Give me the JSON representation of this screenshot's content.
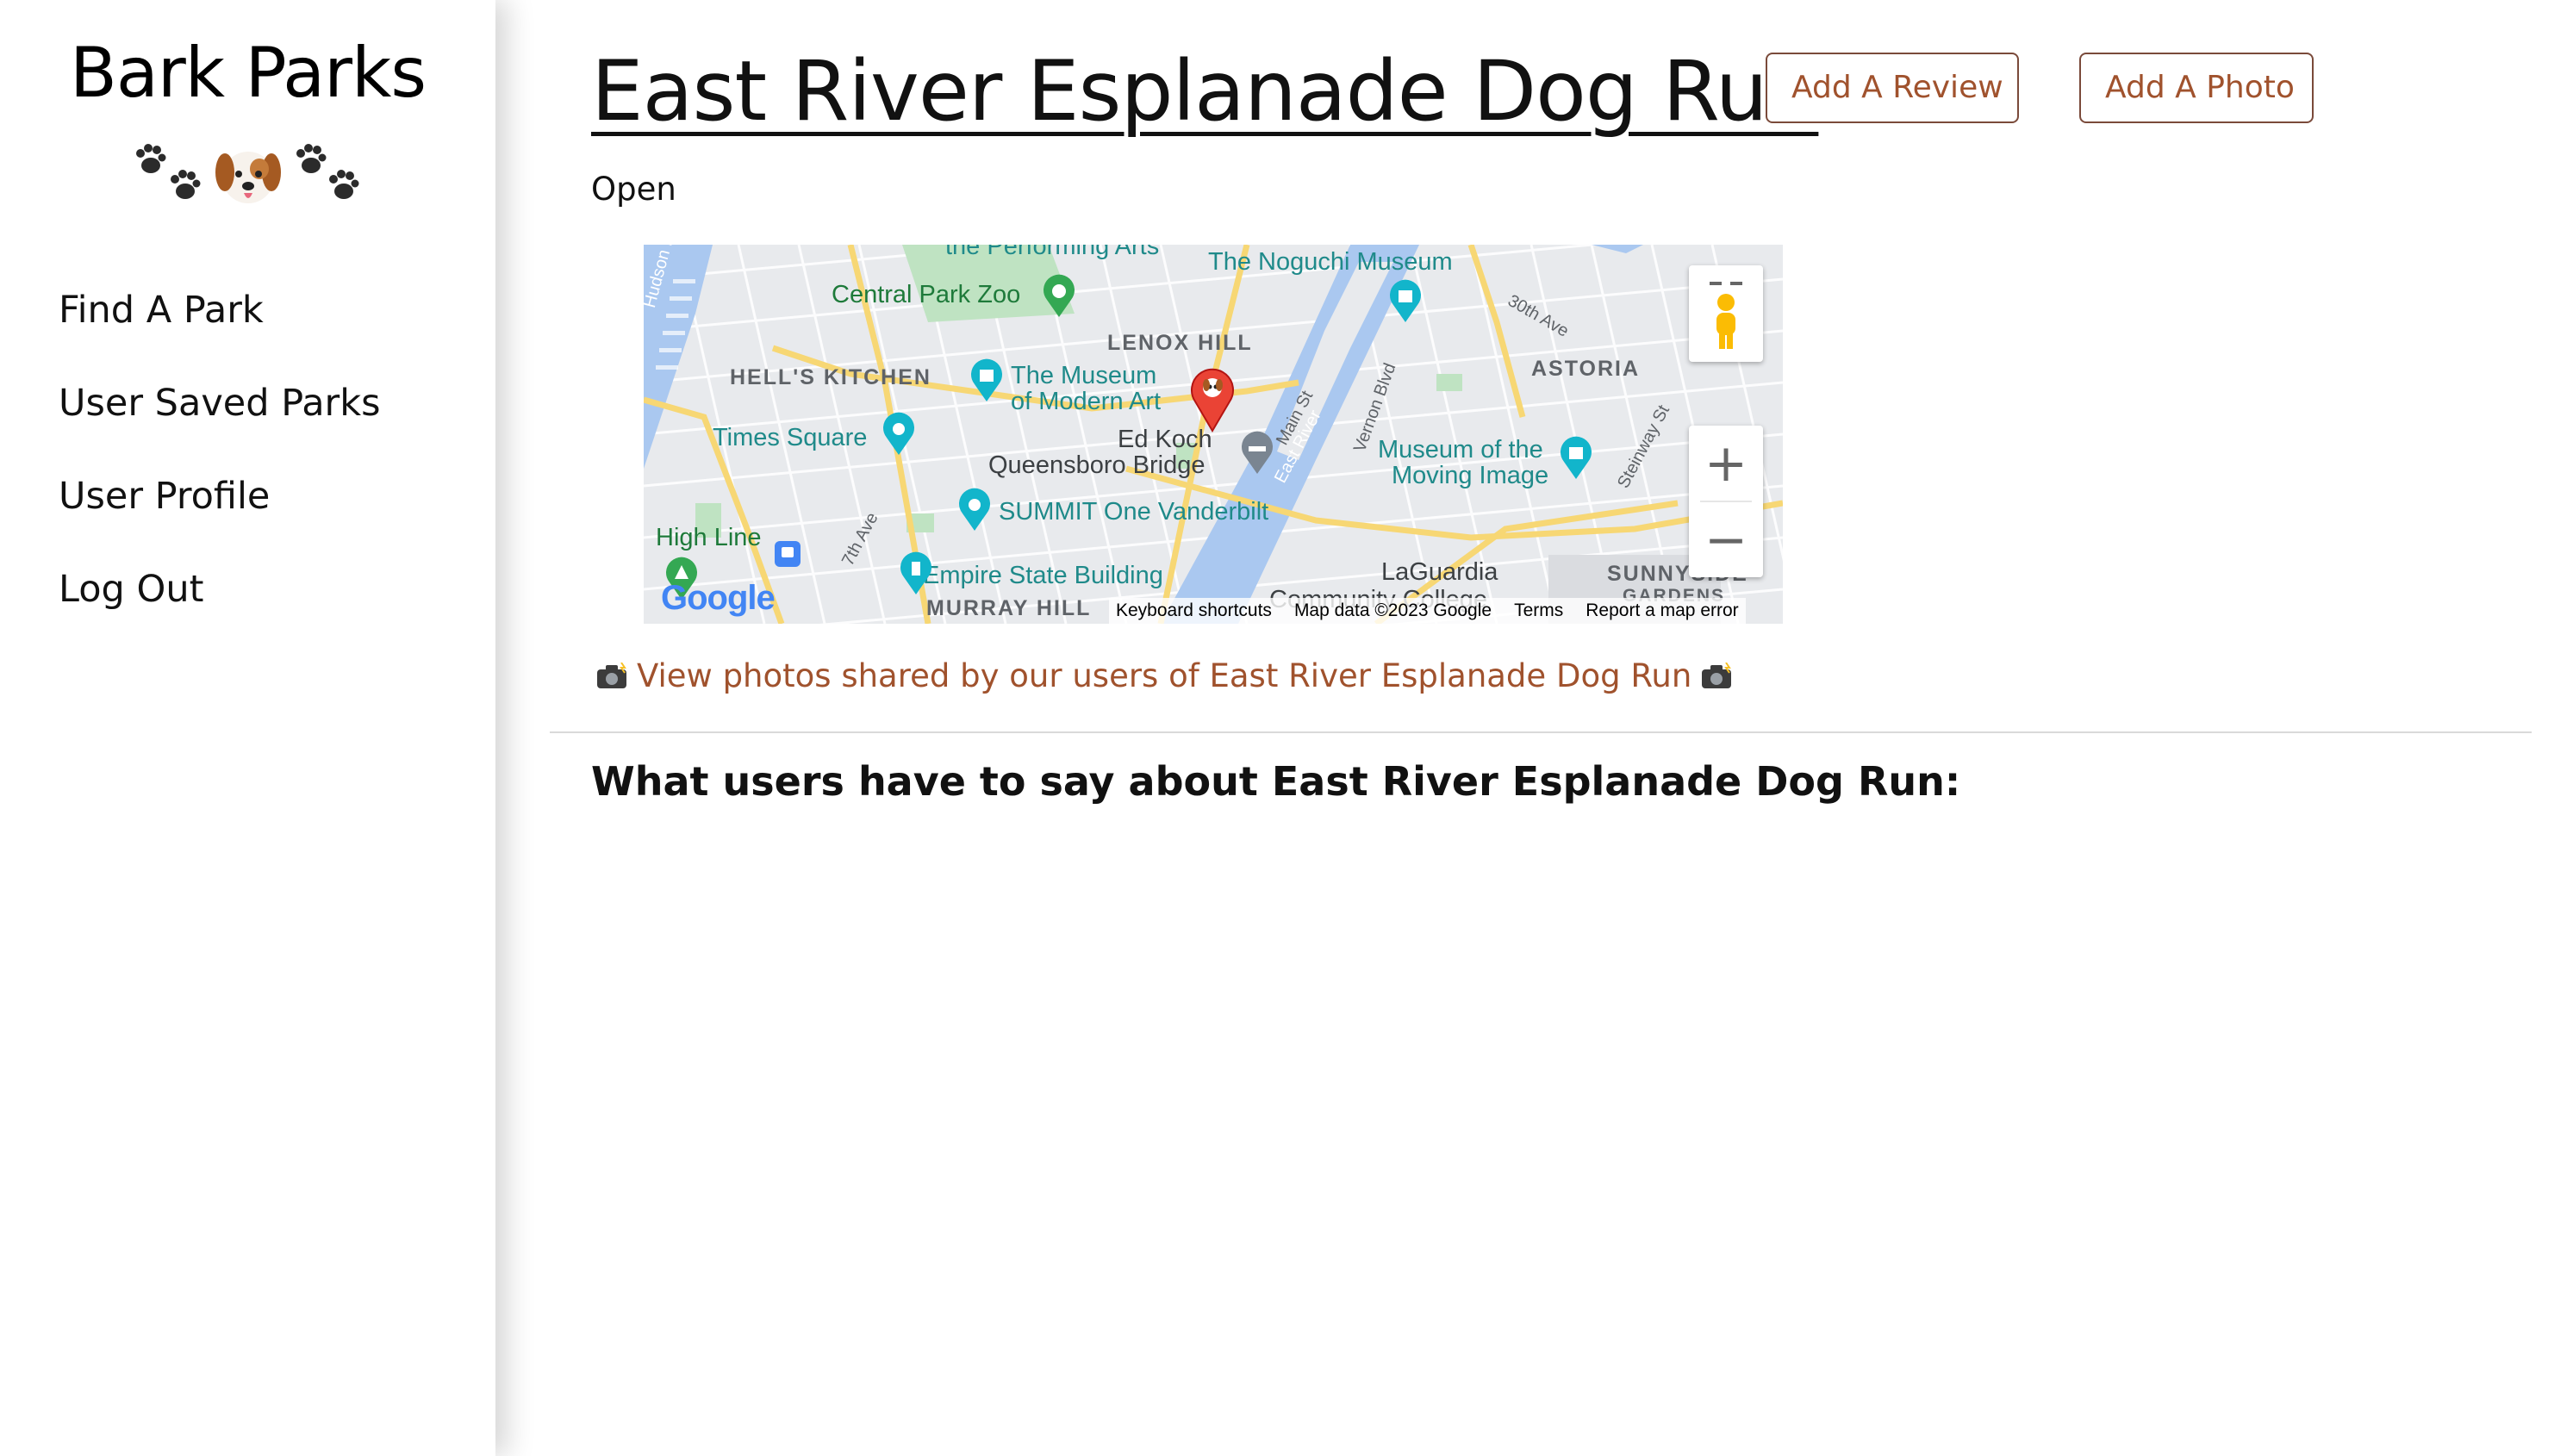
{
  "sidebar": {
    "brand": "Bark Parks",
    "brand_icons": [
      "paw-prints-icon",
      "dog-face-icon",
      "paw-prints-icon"
    ],
    "nav": [
      {
        "label": "Find A Park"
      },
      {
        "label": "User Saved Parks"
      },
      {
        "label": "User Profile"
      },
      {
        "label": "Log Out"
      }
    ]
  },
  "park": {
    "name": "East River Esplanade Dog Run",
    "status": "Open"
  },
  "actions": {
    "add_review": "Add A Review",
    "add_photo": "Add A Photo"
  },
  "map": {
    "labels": {
      "performing_arts": "the Performing Arts",
      "noguchi": "The Noguchi Museum",
      "zoo": "Central Park Zoo",
      "lenox": "LENOX HILL",
      "astoria": "ASTORIA",
      "hells_kitchen": "HELL'S KITCHEN",
      "moma_1": "The Museum",
      "moma_2": "of Modern Art",
      "ed_koch_1": "Ed Koch",
      "ed_koch_2": "Queensboro Bridge",
      "times_square": "Times Square",
      "moving_image_1": "Museum of the",
      "moving_image_2": "Moving Image",
      "summit": "SUMMIT One Vanderbilt",
      "high_line": "High Line",
      "empire": "Empire State Building",
      "laguardia": "LaGuardia",
      "community_college": "Community College",
      "sunnyside_1": "SUNNYSIDE",
      "sunnyside_2": "GARDENS",
      "murray_hill": "MURRAY HILL",
      "hudson_river": "Hudson River",
      "east_river": "East River",
      "main_st": "Main St",
      "vernon_blvd": "Vernon Blvd",
      "thirtieth_ave": "30th Ave",
      "steinway_st": "Steinway St",
      "seventh_ave": "7th Ave"
    },
    "logo": "Google",
    "footer": {
      "shortcuts": "Keyboard shortcuts",
      "map_data": "Map data ©2023 Google",
      "terms": "Terms",
      "report": "Report a map error"
    },
    "zoom_in": "+",
    "zoom_out": "−"
  },
  "photos_link": {
    "text": "View photos shared by our users of East River Esplanade Dog Run",
    "icon": "camera-flash-icon"
  },
  "reviews": {
    "heading": "What users have to say about East River Esplanade Dog Run:"
  },
  "colors": {
    "accent": "#a0522d",
    "button_border": "#7a4a3a",
    "water": "#aac8f0",
    "road_major": "#f7d774",
    "park_green": "#bfe3c2"
  }
}
